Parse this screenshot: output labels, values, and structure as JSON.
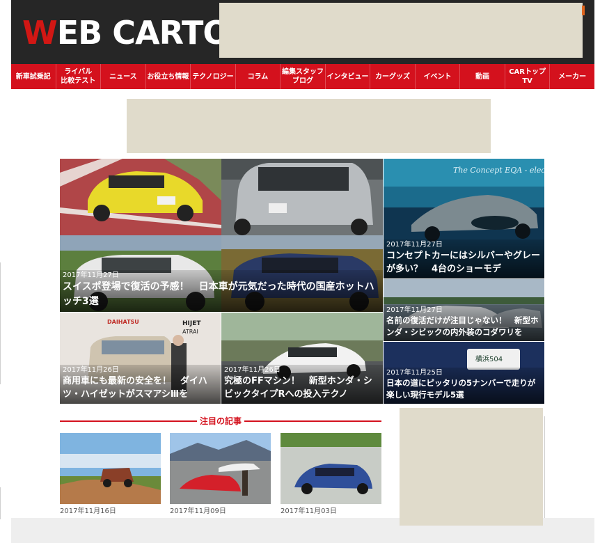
{
  "site": {
    "logo_accent": "W",
    "logo_rest": "EB CARTOP"
  },
  "nav": [
    "新車試乗記",
    "ライバル\n比較テスト",
    "ニュース",
    "お役立ち情報",
    "テクノロジー",
    "コラム",
    "編集スタッフ\nブログ",
    "インタビュー",
    "カーグッズ",
    "イベント",
    "動画",
    "CARトップTV",
    "メーカー"
  ],
  "tiles": [
    {
      "date": "2017年11月27日",
      "title": "スイスポ登場で復活の予感！　日本車が元気だった時代の国産ホットハッチ3選"
    },
    {
      "date": "2017年11月27日",
      "title": "コンセプトカーにはシルバーやグレーが多い？　4台のショーモデ"
    },
    {
      "date": "2017年11月27日",
      "title": "名前の復活だけが注目じゃない！　新型ホンダ・シビックの内外装のコダワリを"
    },
    {
      "date": "2017年11月26日",
      "title": "商用車にも最新の安全を！　ダイハツ・ハイゼットがスマアシⅢを"
    },
    {
      "date": "2017年11月26日",
      "title": "究極のFFマシン！　新型ホンダ・シビックタイプRへの投入テクノ"
    },
    {
      "date": "2017年11月25日",
      "title": "日本の道にピッタリの5ナンバーで走りが楽しい現行モデル5選"
    }
  ],
  "image_text": {
    "concept": "The Concept EQA - electr",
    "plate": "横浜504",
    "brand": "DAIHATSU",
    "hijet": "HIJET",
    "atrai": "ATRAI"
  },
  "featured": {
    "heading": "注目の記事",
    "cards": [
      {
        "date": "2017年11月16日"
      },
      {
        "date": "2017年11月09日"
      },
      {
        "date": "2017年11月03日"
      }
    ]
  },
  "colors": {
    "brand_red": "#d4111d",
    "header_bg": "#262626",
    "ad_placeholder": "#e0dbcb"
  }
}
